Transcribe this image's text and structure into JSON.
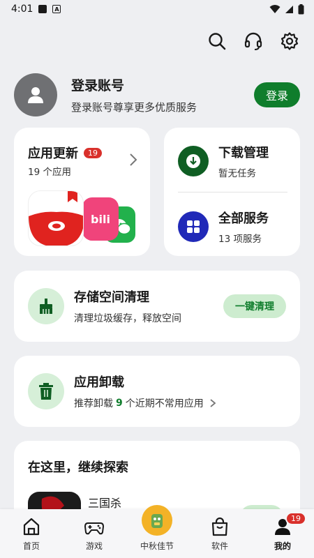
{
  "status_bar": {
    "time": "4:01"
  },
  "toolbar": {
    "icons": [
      "search-icon",
      "headset-icon",
      "gear-icon"
    ]
  },
  "account": {
    "title": "登录账号",
    "subtitle": "登录账号尊享更多优质服务",
    "login_label": "登录"
  },
  "app_update": {
    "title": "应用更新",
    "badge": "19",
    "subtitle": "19 个应用",
    "icons": [
      "tomato-novel-icon",
      "bilibili-icon",
      "wechat-icon"
    ],
    "bili_text": "bili"
  },
  "download": {
    "title": "下载管理",
    "subtitle": "暂无任务"
  },
  "services": {
    "title": "全部服务",
    "subtitle": "13 项服务"
  },
  "storage": {
    "title": "存储空间清理",
    "subtitle": "清理垃圾缓存，释放空间",
    "button": "一键清理"
  },
  "uninstall": {
    "title": "应用卸载",
    "sub_prefix": "推荐卸载",
    "count": "9",
    "sub_suffix": "个近期不常用应用"
  },
  "explore": {
    "title": "在这里，继续探索",
    "item_name": "三国杀"
  },
  "bottom_nav": [
    {
      "label": "首页",
      "icon": "home-icon"
    },
    {
      "label": "游戏",
      "icon": "gamepad-icon"
    },
    {
      "label": "中秋佳节",
      "icon": "festival-icon"
    },
    {
      "label": "软件",
      "icon": "shopping-bag-icon"
    },
    {
      "label": "我的",
      "icon": "person-icon",
      "badge": "19",
      "active": true
    }
  ],
  "colors": {
    "accent": "#0f7d2c",
    "badge": "#d9302b",
    "blue": "#2029b8"
  }
}
